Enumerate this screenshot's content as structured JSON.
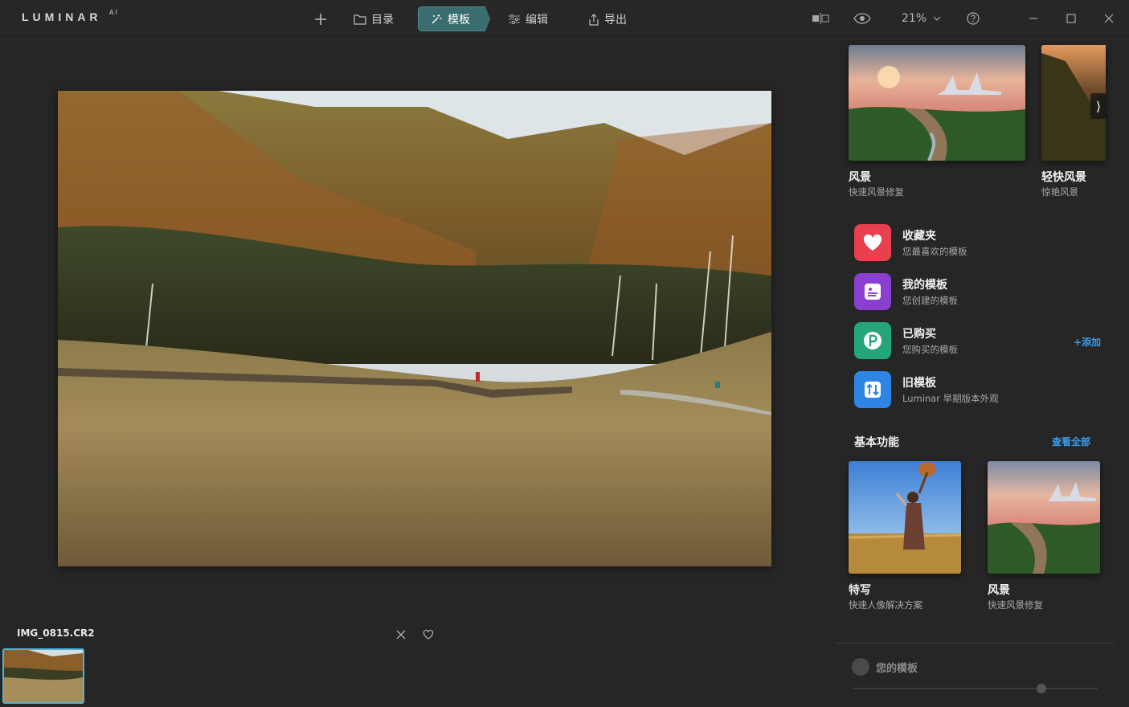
{
  "app": {
    "logo": "LUMINAR",
    "logo_suffix": "AI"
  },
  "toolbar": {
    "add_label": "+",
    "catalog_label": "目录",
    "templates_label": "模板",
    "edit_label": "编辑",
    "export_label": "导出",
    "zoom_label": "21%"
  },
  "colors": {
    "accent": "#3a6d6d",
    "link": "#3d9be9",
    "selection": "#4fb3d9"
  },
  "filmstrip": {
    "filename": "IMG_0815.CR2"
  },
  "right_panel": {
    "featured": [
      {
        "title": "风景",
        "subtitle": "快速风景修复"
      },
      {
        "title": "轻快风景",
        "subtitle": "惊艳风景"
      }
    ],
    "next_arrow": "⟩",
    "categories": [
      {
        "title": "收藏夹",
        "subtitle": "您最喜欢的模板",
        "icon": "heart-icon",
        "color": "#e8404f"
      },
      {
        "title": "我的模板",
        "subtitle": "您创建的模板",
        "icon": "user-card-icon",
        "color": "#8a3fd1"
      },
      {
        "title": "已购买",
        "subtitle": "您购买的模板",
        "icon": "purchase-icon",
        "color": "#25a67a"
      },
      {
        "title": "旧模板",
        "subtitle": "Luminar 早期版本外观",
        "icon": "swap-arrows-icon",
        "color": "#2d86e6"
      }
    ],
    "add_link": "+添加",
    "basic_section": {
      "title": "基本功能",
      "view_all": "查看全部"
    },
    "basic_cards": [
      {
        "title": "特写",
        "subtitle": "快速人像解决方案"
      },
      {
        "title": "风景",
        "subtitle": "快速风景修复"
      }
    ],
    "your_templates": "您的模板",
    "slider_value": 0.77
  }
}
